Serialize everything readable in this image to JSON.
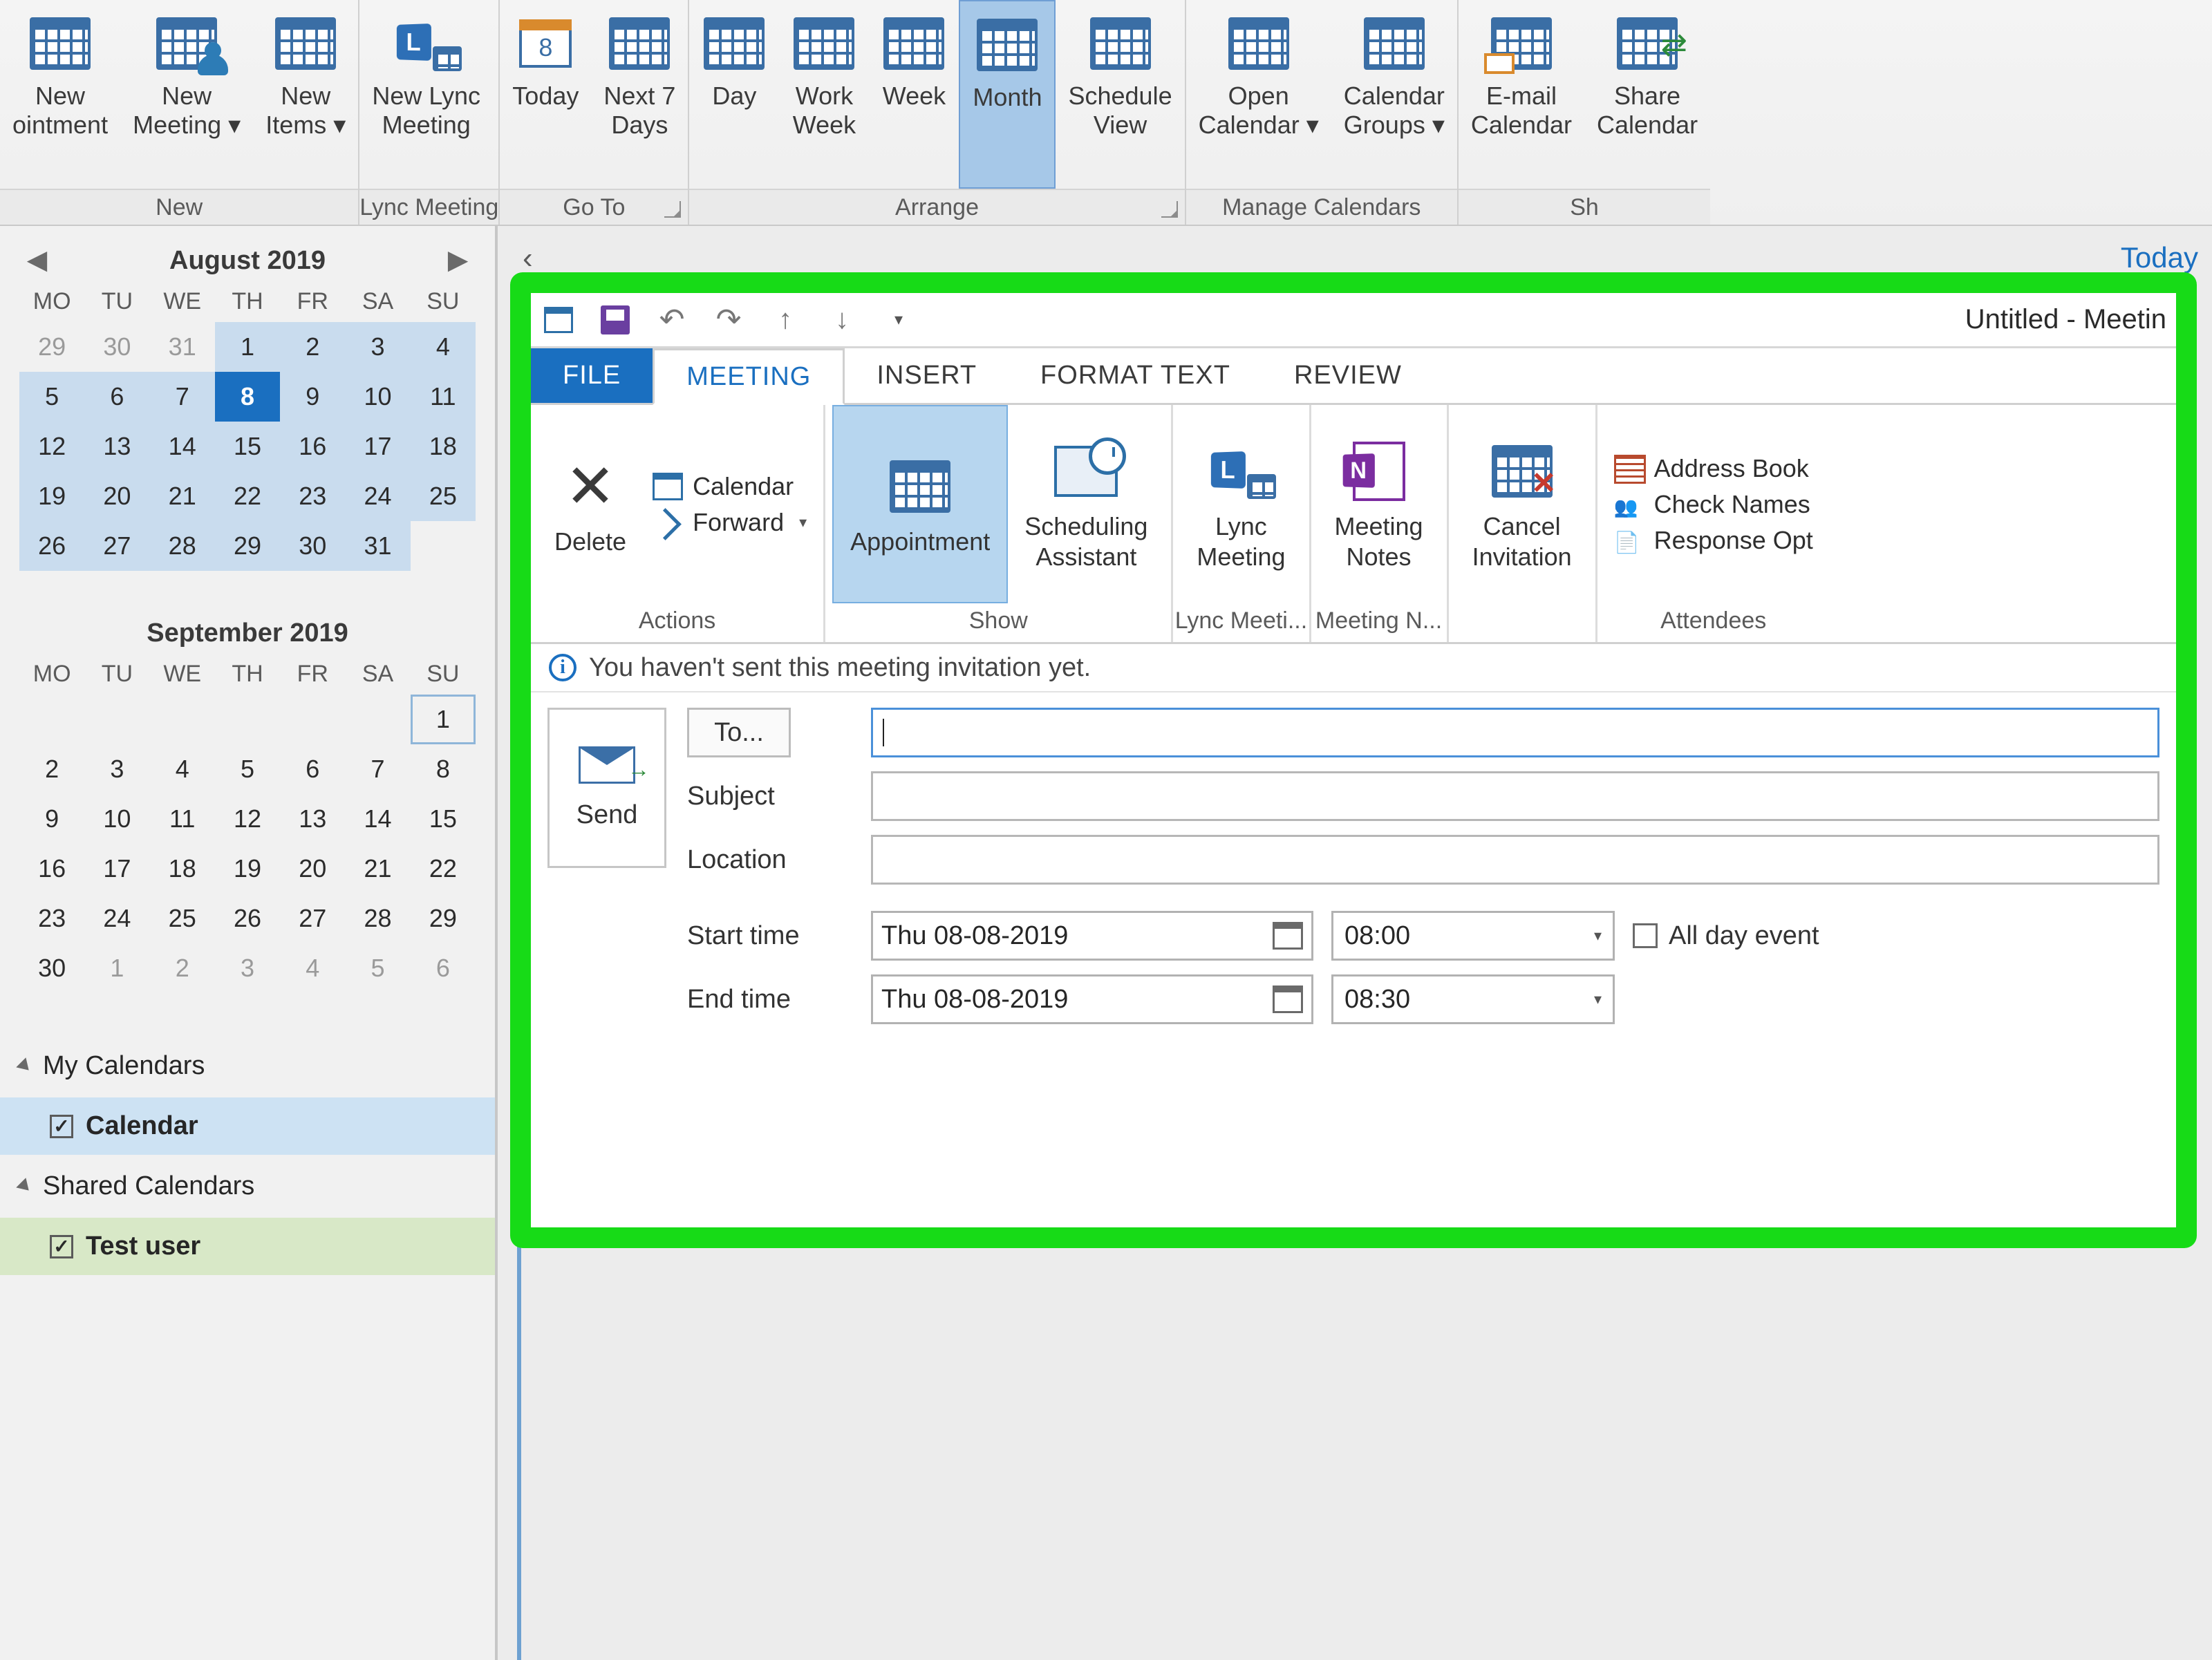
{
  "back_ribbon": {
    "groups": [
      {
        "label": "New",
        "buttons": [
          {
            "label": "New\nointment",
            "name": "new-appointment-button"
          },
          {
            "label": "New\nMeeting",
            "name": "new-meeting-button",
            "dropdown": true
          },
          {
            "label": "New\nItems",
            "name": "new-items-button",
            "dropdown": true
          }
        ]
      },
      {
        "label": "Lync Meeting",
        "buttons": [
          {
            "label": "New Lync\nMeeting",
            "name": "new-lync-meeting-button"
          }
        ]
      },
      {
        "label": "Go To",
        "launcher": true,
        "buttons": [
          {
            "label": "Today",
            "name": "today-button"
          },
          {
            "label": "Next 7\nDays",
            "name": "next7days-button"
          }
        ]
      },
      {
        "label": "Arrange",
        "launcher": true,
        "buttons": [
          {
            "label": "Day",
            "name": "day-view-button"
          },
          {
            "label": "Work\nWeek",
            "name": "workweek-view-button"
          },
          {
            "label": "Week",
            "name": "week-view-button"
          },
          {
            "label": "Month",
            "name": "month-view-button",
            "selected": true
          },
          {
            "label": "Schedule\nView",
            "name": "schedule-view-button"
          }
        ]
      },
      {
        "label": "Manage Calendars",
        "buttons": [
          {
            "label": "Open\nCalendar",
            "name": "open-calendar-button",
            "dropdown": true
          },
          {
            "label": "Calendar\nGroups",
            "name": "calendar-groups-button",
            "dropdown": true
          }
        ]
      },
      {
        "label": "Sh",
        "buttons": [
          {
            "label": "E-mail\nCalendar",
            "name": "email-calendar-button"
          },
          {
            "label": "Share\nCalendar",
            "name": "share-calendar-button"
          }
        ]
      }
    ]
  },
  "today_link": "Today",
  "sidebar": {
    "calendars": [
      {
        "title": "August 2019",
        "nav": true,
        "weekdays": [
          "MO",
          "TU",
          "WE",
          "TH",
          "FR",
          "SA",
          "SU"
        ],
        "rows": [
          [
            {
              "n": "29",
              "dim": true
            },
            {
              "n": "30",
              "dim": true
            },
            {
              "n": "31",
              "dim": true
            },
            {
              "n": "1",
              "r": true
            },
            {
              "n": "2",
              "r": true
            },
            {
              "n": "3",
              "r": true
            },
            {
              "n": "4",
              "r": true
            }
          ],
          [
            {
              "n": "5",
              "r": true
            },
            {
              "n": "6",
              "r": true
            },
            {
              "n": "7",
              "r": true
            },
            {
              "n": "8",
              "today": true
            },
            {
              "n": "9",
              "r": true
            },
            {
              "n": "10",
              "r": true
            },
            {
              "n": "11",
              "r": true
            }
          ],
          [
            {
              "n": "12",
              "r": true
            },
            {
              "n": "13",
              "r": true
            },
            {
              "n": "14",
              "r": true
            },
            {
              "n": "15",
              "r": true
            },
            {
              "n": "16",
              "r": true
            },
            {
              "n": "17",
              "r": true
            },
            {
              "n": "18",
              "r": true
            }
          ],
          [
            {
              "n": "19",
              "r": true
            },
            {
              "n": "20",
              "r": true
            },
            {
              "n": "21",
              "r": true
            },
            {
              "n": "22",
              "r": true
            },
            {
              "n": "23",
              "r": true
            },
            {
              "n": "24",
              "r": true
            },
            {
              "n": "25",
              "r": true
            }
          ],
          [
            {
              "n": "26",
              "r": true
            },
            {
              "n": "27",
              "r": true
            },
            {
              "n": "28",
              "r": true
            },
            {
              "n": "29",
              "r": true
            },
            {
              "n": "30",
              "r": true
            },
            {
              "n": "31",
              "r": true
            },
            {
              "n": ""
            }
          ]
        ]
      },
      {
        "title": "September 2019",
        "nav": false,
        "weekdays": [
          "MO",
          "TU",
          "WE",
          "TH",
          "FR",
          "SA",
          "SU"
        ],
        "rows": [
          [
            {
              "n": ""
            },
            {
              "n": ""
            },
            {
              "n": ""
            },
            {
              "n": ""
            },
            {
              "n": ""
            },
            {
              "n": ""
            },
            {
              "n": "1",
              "sel": true
            }
          ],
          [
            {
              "n": "2"
            },
            {
              "n": "3"
            },
            {
              "n": "4"
            },
            {
              "n": "5"
            },
            {
              "n": "6"
            },
            {
              "n": "7"
            },
            {
              "n": "8"
            }
          ],
          [
            {
              "n": "9"
            },
            {
              "n": "10"
            },
            {
              "n": "11"
            },
            {
              "n": "12"
            },
            {
              "n": "13"
            },
            {
              "n": "14"
            },
            {
              "n": "15"
            }
          ],
          [
            {
              "n": "16"
            },
            {
              "n": "17"
            },
            {
              "n": "18"
            },
            {
              "n": "19"
            },
            {
              "n": "20"
            },
            {
              "n": "21"
            },
            {
              "n": "22"
            }
          ],
          [
            {
              "n": "23"
            },
            {
              "n": "24"
            },
            {
              "n": "25"
            },
            {
              "n": "26"
            },
            {
              "n": "27"
            },
            {
              "n": "28"
            },
            {
              "n": "29"
            }
          ],
          [
            {
              "n": "30"
            },
            {
              "n": "1",
              "dim": true
            },
            {
              "n": "2",
              "dim": true
            },
            {
              "n": "3",
              "dim": true
            },
            {
              "n": "4",
              "dim": true
            },
            {
              "n": "5",
              "dim": true
            },
            {
              "n": "6",
              "dim": true
            }
          ]
        ]
      }
    ],
    "calendar_groups": [
      {
        "title": "My Calendars",
        "items": [
          {
            "label": "Calendar",
            "checked": true,
            "selected": "blue"
          }
        ]
      },
      {
        "title": "Shared Calendars",
        "items": [
          {
            "label": "Test user",
            "checked": true,
            "selected": "green"
          }
        ]
      }
    ]
  },
  "meeting": {
    "window_title": "Untitled - Meetin",
    "tabs": [
      "FILE",
      "MEETING",
      "INSERT",
      "FORMAT TEXT",
      "REVIEW"
    ],
    "active_tab": "MEETING",
    "ribbon_groups": [
      {
        "label": "Actions",
        "big": [
          {
            "label": "Delete",
            "name": "delete-button",
            "icon": "delete"
          }
        ],
        "small": [
          {
            "label": "Calendar",
            "name": "calendar-button",
            "icon": "calendar"
          },
          {
            "label": "Forward",
            "name": "forward-button",
            "icon": "forward",
            "dropdown": true
          }
        ]
      },
      {
        "label": "Show",
        "big": [
          {
            "label": "Appointment",
            "name": "appointment-button",
            "icon": "appointment",
            "selected": true
          },
          {
            "label": "Scheduling\nAssistant",
            "name": "scheduling-assistant-button",
            "icon": "sched"
          }
        ]
      },
      {
        "label": "Lync Meeti...",
        "big": [
          {
            "label": "Lync\nMeeting",
            "name": "lync-meeting-button",
            "icon": "lync"
          }
        ]
      },
      {
        "label": "Meeting N...",
        "big": [
          {
            "label": "Meeting\nNotes",
            "name": "meeting-notes-button",
            "icon": "onenote"
          }
        ]
      },
      {
        "label": "",
        "big": [
          {
            "label": "Cancel\nInvitation",
            "name": "cancel-invitation-button",
            "icon": "cancel"
          }
        ]
      },
      {
        "label": "Attendees",
        "small": [
          {
            "label": "Address Book",
            "name": "address-book-button",
            "icon": "ab"
          },
          {
            "label": "Check Names",
            "name": "check-names-button",
            "icon": "check"
          },
          {
            "label": "Response Opt",
            "name": "response-options-button",
            "icon": "response"
          }
        ]
      }
    ],
    "info_message": "You haven't sent this meeting invitation yet.",
    "form": {
      "send_label": "Send",
      "to_button": "To...",
      "to_value": "",
      "subject_label": "Subject",
      "subject_value": "",
      "location_label": "Location",
      "location_value": "",
      "start_label": "Start time",
      "start_date": "Thu 08-08-2019",
      "start_time": "08:00",
      "end_label": "End time",
      "end_date": "Thu 08-08-2019",
      "end_time": "08:30",
      "allday_label": "All day event",
      "allday_checked": false
    }
  }
}
